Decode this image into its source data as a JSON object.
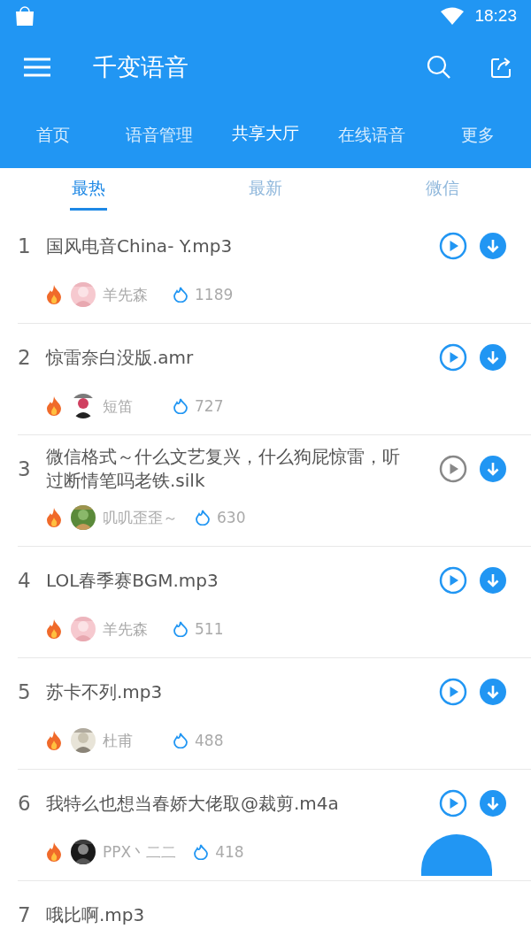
{
  "status_bar": {
    "time": "18:23"
  },
  "app_bar": {
    "title": "千变语音"
  },
  "tabs": [
    {
      "label": "首页",
      "selected": false
    },
    {
      "label": "语音管理",
      "selected": false
    },
    {
      "label": "共享大厅",
      "selected": true
    },
    {
      "label": "在线语音",
      "selected": false
    },
    {
      "label": "更多",
      "selected": false
    }
  ],
  "sub_tabs": [
    {
      "label": "最热",
      "selected": true
    },
    {
      "label": "最新",
      "selected": false
    },
    {
      "label": "微信",
      "selected": false
    }
  ],
  "items": [
    {
      "rank": "1",
      "title": "国风电音China- Y.mp3",
      "user": "羊先森",
      "count": "1189",
      "play_active": true
    },
    {
      "rank": "2",
      "title": "惊雷奈白没版.amr",
      "user": "短笛",
      "count": "727",
      "play_active": true
    },
    {
      "rank": "3",
      "title": "微信格式～什么文艺复兴，什么狗屁惊雷，听过断情笔吗老铁.silk",
      "user": "叽叽歪歪～",
      "count": "630",
      "play_active": false
    },
    {
      "rank": "4",
      "title": "LOL春季赛BGM.mp3",
      "user": "羊先森",
      "count": "511",
      "play_active": true
    },
    {
      "rank": "5",
      "title": "苏卡不列.mp3",
      "user": "杜甫",
      "count": "488",
      "play_active": true
    },
    {
      "rank": "6",
      "title": "我特么也想当春娇大佬取@裁剪.m4a",
      "user": "PPX丶二二",
      "count": "418",
      "play_active": true
    },
    {
      "rank": "7",
      "title": "哦比啊.mp3"
    }
  ]
}
